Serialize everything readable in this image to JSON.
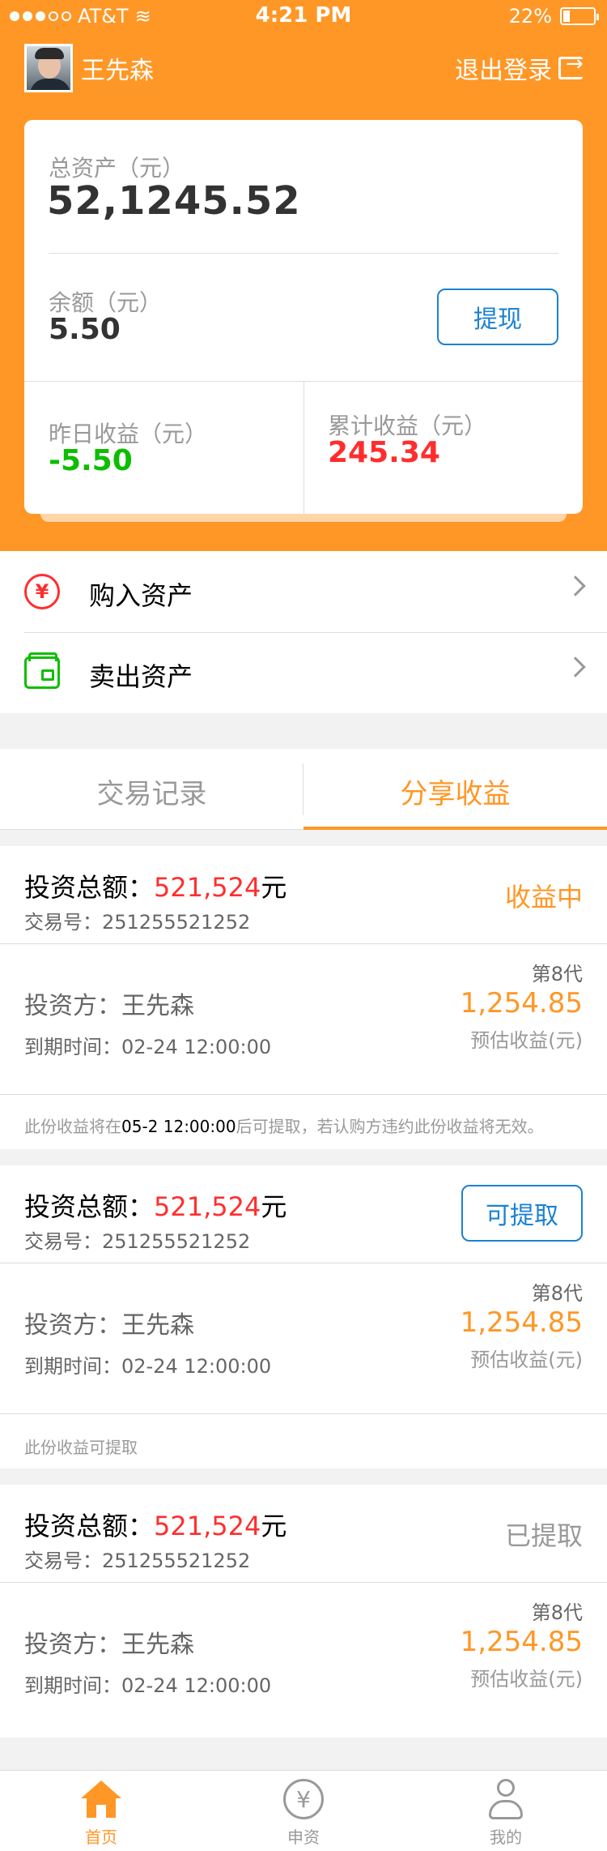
{
  "status_bar": {
    "carrier": "AT&T",
    "time": "4:21 PM",
    "battery": "22%",
    "battery_level": 0.22
  },
  "header": {
    "username": "王先森",
    "logout": "退出登录"
  },
  "assets": {
    "total_label": "总资产（元）",
    "total_value": "52,1245.52",
    "balance_label": "余额（元）",
    "balance_value": "5.50",
    "withdraw_button": "提现",
    "yesterday_label": "昨日收益（元）",
    "yesterday_value": "-5.50",
    "cumulative_label": "累计收益（元）",
    "cumulative_value": "245.34"
  },
  "menu": {
    "buy": "购入资产",
    "sell": "卖出资产"
  },
  "tabs": {
    "records": "交易记录",
    "share": "分享收益",
    "active": "share"
  },
  "records": [
    {
      "title_prefix": "投资总额：",
      "amount": "521,524",
      "unit": "元",
      "txn": "交易号：251255521252",
      "status": "收益中",
      "status_color": "#FF9726",
      "investor": "投资方：王先森",
      "expiry": "到期时间：02-24 12:00:00",
      "generation": "第8代",
      "income": "1,254.85",
      "income_label": "预估收益(元)",
      "note_pre": "此份收益将在",
      "note_date": "05-2",
      "note_mid": " 12:00:00",
      "note_post": "后可提取，若认购方违约此份收益将无效。"
    },
    {
      "title_prefix": "投资总额：",
      "amount": "521,524",
      "unit": "元",
      "txn": "交易号：251255521252",
      "status": "可提取",
      "investor": "投资方：王先森",
      "expiry": "到期时间：02-24 12:00:00",
      "generation": "第8代",
      "income": "1,254.85",
      "income_label": "预估收益(元)",
      "note": "此份收益可提取"
    },
    {
      "title_prefix": "投资总额：",
      "amount": "521,524",
      "unit": "元",
      "txn": "交易号：251255521252",
      "status": "已提取",
      "status_color": "#999999",
      "investor": "投资方：王先森",
      "expiry": "到期时间：02-24 12:00:00",
      "generation": "第8代",
      "income": "1,254.85",
      "income_label": "预估收益(元)"
    }
  ],
  "tabbar": {
    "home": "首页",
    "invest": "申资",
    "mine": "我的",
    "active": "home"
  },
  "colors": {
    "brand": "#FF9726",
    "blue": "#1B82D2",
    "red": "#FF2E2E",
    "green": "#0DBE00",
    "divider": "#DDDDDD",
    "bg": "#F2F2F2"
  }
}
